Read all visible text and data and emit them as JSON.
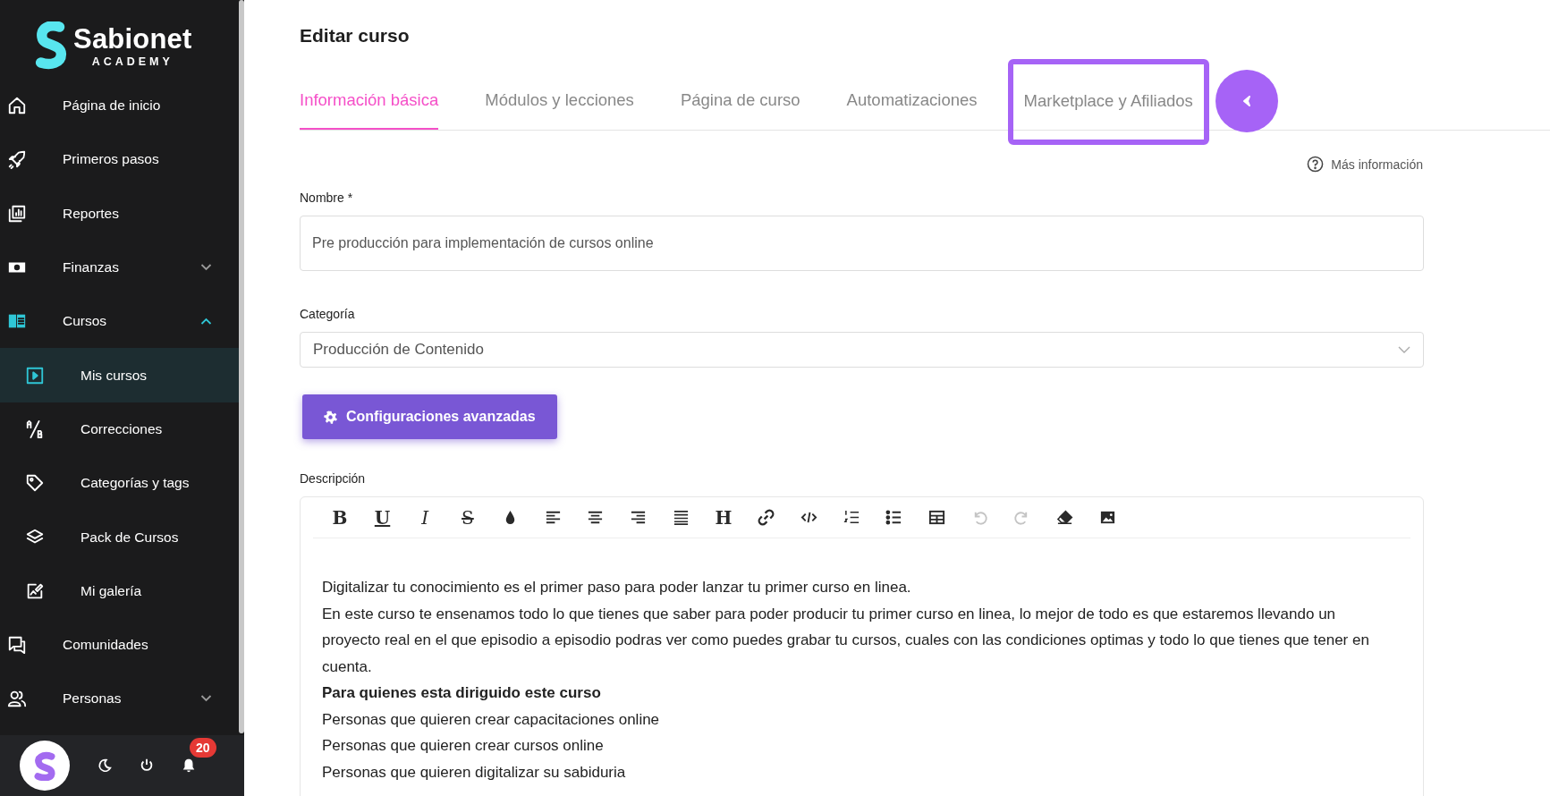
{
  "brand": {
    "name": "Sabionet",
    "tagline": "ACADEMY"
  },
  "sidebar": {
    "items": [
      {
        "label": "Página de inicio"
      },
      {
        "label": "Primeros pasos"
      },
      {
        "label": "Reportes"
      },
      {
        "label": "Finanzas",
        "expanded": false
      },
      {
        "label": "Cursos",
        "expanded": true,
        "children": [
          {
            "label": "Mis cursos",
            "selected": true
          },
          {
            "label": "Correcciones",
            "selected": false
          },
          {
            "label": "Categorías y tags",
            "selected": false
          },
          {
            "label": "Pack de Cursos",
            "selected": false
          },
          {
            "label": "Mi galería",
            "selected": false
          }
        ]
      },
      {
        "label": "Comunidades"
      },
      {
        "label": "Personas",
        "expanded": false
      }
    ]
  },
  "footer": {
    "notifications": "20"
  },
  "page": {
    "title": "Editar curso",
    "tabs": [
      {
        "label": "Información básica",
        "selected": true,
        "highlighted": false
      },
      {
        "label": "Módulos y lecciones",
        "selected": false,
        "highlighted": false
      },
      {
        "label": "Página de curso",
        "selected": false,
        "highlighted": false
      },
      {
        "label": "Automatizaciones",
        "selected": false,
        "highlighted": false
      },
      {
        "label": "Marketplace y Afiliados",
        "selected": false,
        "highlighted": true
      }
    ],
    "help_link": "Más información",
    "name_field": {
      "label": "Nombre *",
      "value": "Pre producción para implementación de cursos online"
    },
    "category_field": {
      "label": "Categoría",
      "value": "Producción de Contenido"
    },
    "advanced_button": "Configuraciones avanzadas",
    "description": {
      "label": "Descripción",
      "toolbar": [
        {
          "kind": "bold",
          "label": "B",
          "disabled": false
        },
        {
          "kind": "underline",
          "label": "U",
          "disabled": false
        },
        {
          "kind": "italic",
          "label": "I",
          "disabled": false
        },
        {
          "kind": "strike",
          "label": "S",
          "disabled": false
        },
        {
          "kind": "color",
          "disabled": false
        },
        {
          "kind": "align-left",
          "disabled": false
        },
        {
          "kind": "align-center",
          "disabled": false
        },
        {
          "kind": "align-right",
          "disabled": false
        },
        {
          "kind": "justify",
          "disabled": false
        },
        {
          "kind": "heading",
          "label": "H",
          "disabled": false
        },
        {
          "kind": "link",
          "disabled": false
        },
        {
          "kind": "code",
          "disabled": false
        },
        {
          "kind": "ordered-list",
          "disabled": false
        },
        {
          "kind": "bullet-list",
          "disabled": false
        },
        {
          "kind": "table",
          "disabled": false
        },
        {
          "kind": "undo",
          "disabled": true
        },
        {
          "kind": "redo",
          "disabled": true
        },
        {
          "kind": "eraser",
          "disabled": false
        },
        {
          "kind": "image",
          "disabled": false
        }
      ],
      "paragraphs": [
        {
          "kind": "normal",
          "text": "Digitalizar tu conocimiento es el primer paso para poder lanzar tu primer curso en linea."
        },
        {
          "kind": "normal",
          "text": "En este curso te ensenamos todo lo que tienes que saber para poder producir tu primer curso en linea, lo mejor de todo es que estaremos llevando un proyecto real en el que episodio a episodio podras ver como puedes grabar tu cursos, cuales con las condiciones optimas y todo lo que tienes que tener en cuenta."
        },
        {
          "kind": "bold",
          "text": "Para quienes esta diriguido este curso"
        },
        {
          "kind": "normal",
          "text": "Personas que quieren crear capacitaciones online"
        },
        {
          "kind": "normal",
          "text": "Personas que quieren crear cursos online"
        },
        {
          "kind": "normal",
          "text": "Personas que quieren digitalizar su sabiduria"
        }
      ]
    }
  }
}
